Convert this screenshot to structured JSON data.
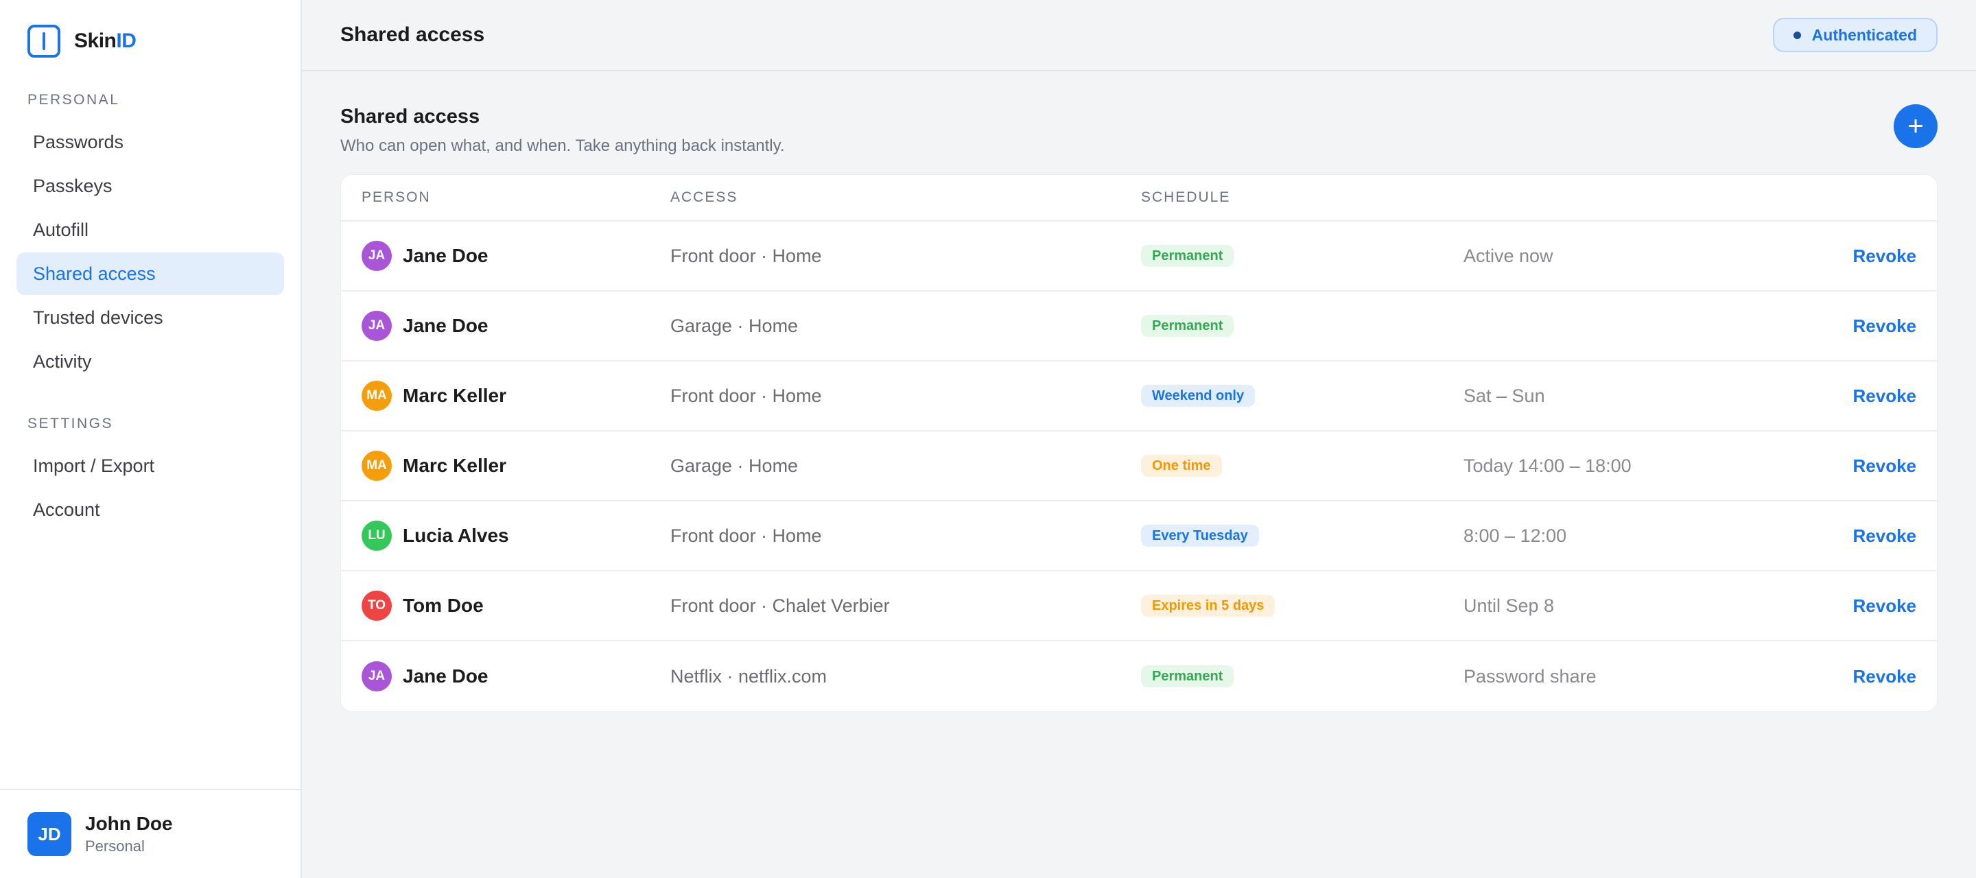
{
  "brand": {
    "name_main": "Skin",
    "name_accent": "ID"
  },
  "sidebar": {
    "sections": [
      {
        "label": "PERSONAL",
        "items": [
          "Passwords",
          "Passkeys",
          "Autofill",
          "Shared access",
          "Trusted devices",
          "Activity"
        ]
      },
      {
        "label": "SETTINGS",
        "items": [
          "Import / Export",
          "Account"
        ]
      }
    ],
    "active_item": "Shared access",
    "user": {
      "initials": "JD",
      "name": "John Doe",
      "subtitle": "Personal"
    }
  },
  "topbar": {
    "title": "Shared access",
    "status_badge": "Authenticated"
  },
  "main": {
    "title": "Shared access",
    "subtitle": "Who can open what, and when. Take anything back instantly.",
    "add_button": "+",
    "columns": [
      "PERSON",
      "ACCESS",
      "SCHEDULE"
    ],
    "rows": [
      {
        "initials": "JA",
        "avatar_color": "#a855d8",
        "person": "Jane Doe",
        "access": "Front door · Home",
        "schedule": "Permanent",
        "schedule_tone": "green",
        "detail": "Active now",
        "action": "Revoke"
      },
      {
        "initials": "JA",
        "avatar_color": "#a855d8",
        "person": "Jane Doe",
        "access": "Garage · Home",
        "schedule": "Permanent",
        "schedule_tone": "green",
        "detail": "",
        "action": "Revoke"
      },
      {
        "initials": "MA",
        "avatar_color": "#f59e0b",
        "person": "Marc Keller",
        "access": "Front door · Home",
        "schedule": "Weekend only",
        "schedule_tone": "blue",
        "detail": "Sat – Sun",
        "action": "Revoke"
      },
      {
        "initials": "MA",
        "avatar_color": "#f59e0b",
        "person": "Marc Keller",
        "access": "Garage · Home",
        "schedule": "One time",
        "schedule_tone": "orange",
        "detail": "Today 14:00 – 18:00",
        "action": "Revoke"
      },
      {
        "initials": "LU",
        "avatar_color": "#34c759",
        "person": "Lucia Alves",
        "access": "Front door · Home",
        "schedule": "Every Tuesday",
        "schedule_tone": "blue",
        "detail": "8:00 – 12:00",
        "action": "Revoke"
      },
      {
        "initials": "TO",
        "avatar_color": "#ef4444",
        "person": "Tom Doe",
        "access": "Front door · Chalet Verbier",
        "schedule": "Expires in 5 days",
        "schedule_tone": "orange",
        "detail": "Until Sep 8",
        "action": "Revoke"
      },
      {
        "initials": "JA",
        "avatar_color": "#a855d8",
        "person": "Jane Doe",
        "access": "Netflix · netflix.com",
        "schedule": "Permanent",
        "schedule_tone": "green",
        "detail": "Password share",
        "action": "Revoke"
      }
    ]
  },
  "colors": {
    "accent": "#1a73e8",
    "green": "#34a853",
    "orange": "#f29900"
  },
  "icons": {
    "logo": "skinid-logo-icon",
    "add": "plus-icon",
    "status": "status-dot-icon"
  }
}
